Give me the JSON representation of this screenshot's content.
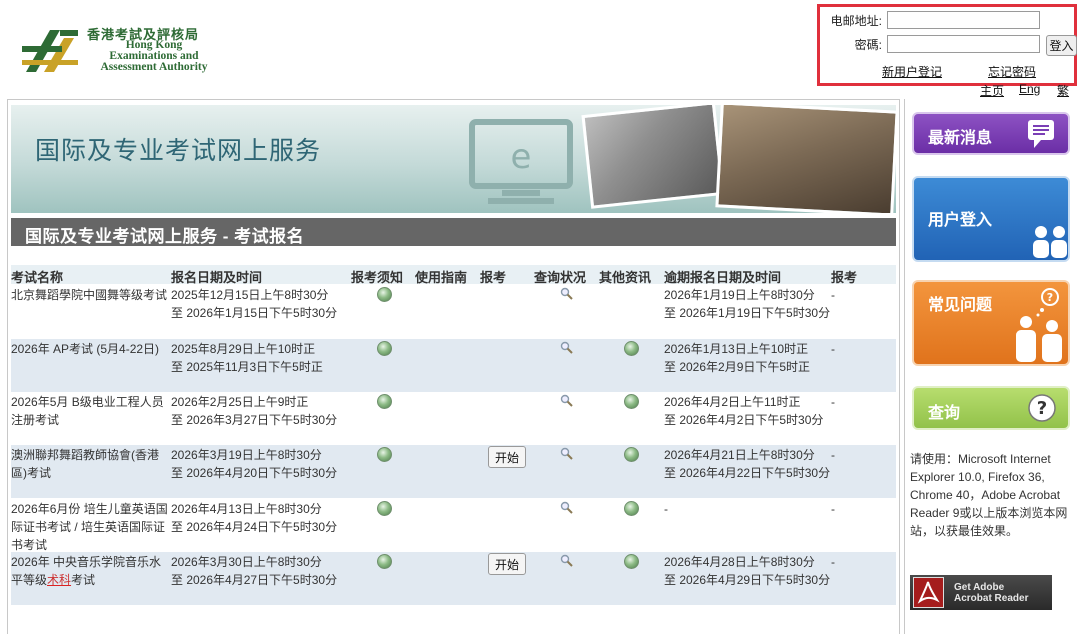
{
  "header": {
    "logo_zh": "香港考試及評核局",
    "logo_en": [
      "Hong Kong",
      "Examinations and",
      "Assessment Authority"
    ]
  },
  "login": {
    "email_label": "电邮地址:",
    "password_label": "密碼:",
    "email_value": "",
    "password_value": "",
    "login_button": "登入",
    "register_link": "新用户登记",
    "forgot_link": "忘记密码"
  },
  "lang": {
    "home": "主页",
    "eng": "Eng",
    "trad": "繁"
  },
  "banner": {
    "title": "国际及专业考试网上服务"
  },
  "section": {
    "title": "国际及专业考试网上服务 - 考试报名"
  },
  "table": {
    "headers": [
      "考试名称",
      "报名日期及时间",
      "报考须知",
      "使用指南",
      "报考",
      "查询状况",
      "其他资讯",
      "逾期报名日期及时间",
      "报考"
    ],
    "start_label": "开始",
    "rows": [
      {
        "name": "北京舞蹈學院中國舞等级考试",
        "date1": "2025年12月15日上午8时30分",
        "date2": "至 2026年1月15日下午5时30分",
        "late1": "2026年1月19日上午8时30分",
        "late2": "至 2026年1月19日下午5时30分",
        "dash": "-"
      },
      {
        "name": "2026年 AP考试 (5月4-22日)",
        "date1": "2025年8月29日上午10时正",
        "date2": "至 2025年11月3日下午5时正",
        "late1": "2026年1月13日上午10时正",
        "late2": "至 2026年2月9日下午5时正",
        "dash": "-"
      },
      {
        "name": "2026年5月 B级电业工程人员注册考试",
        "date1": "2026年2月25日上午9时正",
        "date2": "至 2026年3月27日下午5时30分",
        "late1": "2026年4月2日上午11时正",
        "late2": "至 2026年4月2日下午5时30分",
        "dash": "-"
      },
      {
        "name": "澳洲聯邦舞蹈教師協會(香港區)考试",
        "date1": "2026年3月19日上午8时30分",
        "date2": "至 2026年4月20日下午5时30分",
        "late1": "2026年4月21日上午8时30分",
        "late2": "至 2026年4月22日下午5时30分",
        "dash": "-"
      },
      {
        "name": "2026年6月份 培生儿童英语国际证书考试 / 培生英语国际证书考试",
        "date1": "2026年4月13日上午8时30分",
        "date2": "至 2026年4月24日下午5时30分",
        "late1": "-",
        "late2": "",
        "dash": "-"
      },
      {
        "name_a": "2026年 中央音乐学院音乐水平等级",
        "name_b": "术科",
        "name_c": "考试",
        "date1": "2026年3月30日上午8时30分",
        "date2": "至 2026年4月27日下午5时30分",
        "late1": "2026年4月28日上午8时30分",
        "late2": "至 2026年4月29日下午5时30分",
        "dash": "-"
      }
    ]
  },
  "sidebar": {
    "news": "最新消息",
    "user_login": "用户登入",
    "faq": "常见问题",
    "query": "查询",
    "note": "请使用：Microsoft Internet Explorer 10.0, Firefox 36, Chrome 40，Adobe Acrobat Reader 9或以上版本浏览本网站，以获最佳效果。",
    "adobe_line1": "Get Adobe",
    "adobe_line2": "Acrobat Reader"
  },
  "colors": {
    "login_border": "#e0303c",
    "section_bar": "#666666",
    "row_shade": "#e1e9f1",
    "logo_green": "#2e6b35"
  }
}
